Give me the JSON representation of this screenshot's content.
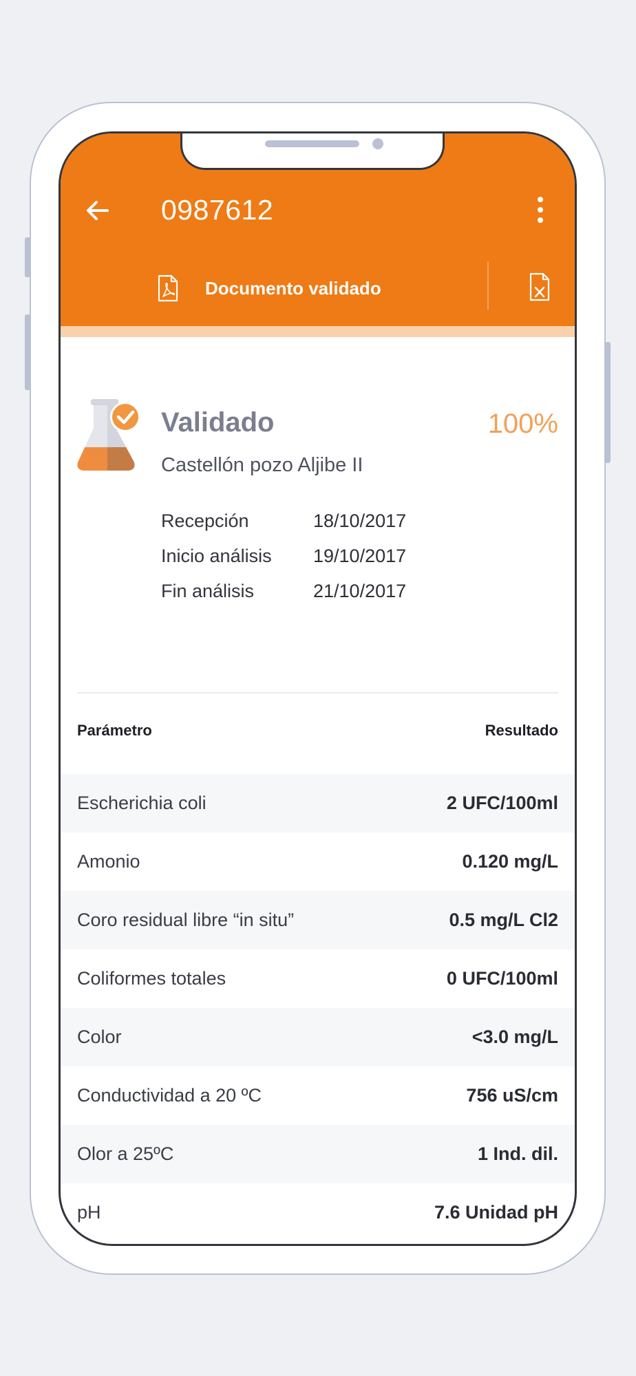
{
  "header": {
    "title": "0987612",
    "document_label": "Documento validado"
  },
  "colors": {
    "accent": "#ee7b15",
    "accent_light": "#f9d1ad",
    "percent": "#f3a056"
  },
  "icons": {
    "back": "arrow-left-icon",
    "menu": "more-vertical-icon",
    "pdf": "pdf-file-icon",
    "excel": "excel-file-icon",
    "status": "flask-check-icon"
  },
  "summary": {
    "status": "Validado",
    "percent": "100%",
    "progress": 1.0,
    "location": "Castellón pozo Aljibe II",
    "dates": [
      {
        "label": "Recepción",
        "value": "18/10/2017"
      },
      {
        "label": "Inicio análisis",
        "value": "19/10/2017"
      },
      {
        "label": "Fin análisis",
        "value": "21/10/2017"
      }
    ]
  },
  "table": {
    "headers": {
      "param": "Parámetro",
      "result": "Resultado"
    },
    "rows": [
      {
        "param": "Escherichia coli",
        "result": "2 UFC/100ml"
      },
      {
        "param": "Amonio",
        "result": "0.120 mg/L"
      },
      {
        "param": "Coro residual libre “in situ”",
        "result": "0.5 mg/L Cl2"
      },
      {
        "param": "Coliformes totales",
        "result": "0 UFC/100ml"
      },
      {
        "param": "Color",
        "result": "<3.0 mg/L"
      },
      {
        "param": "Conductividad a 20 ºC",
        "result": "756 uS/cm"
      },
      {
        "param": "Olor a 25ºC",
        "result": "1 Ind. dil."
      },
      {
        "param": "pH",
        "result": "7.6 Unidad pH"
      }
    ]
  }
}
